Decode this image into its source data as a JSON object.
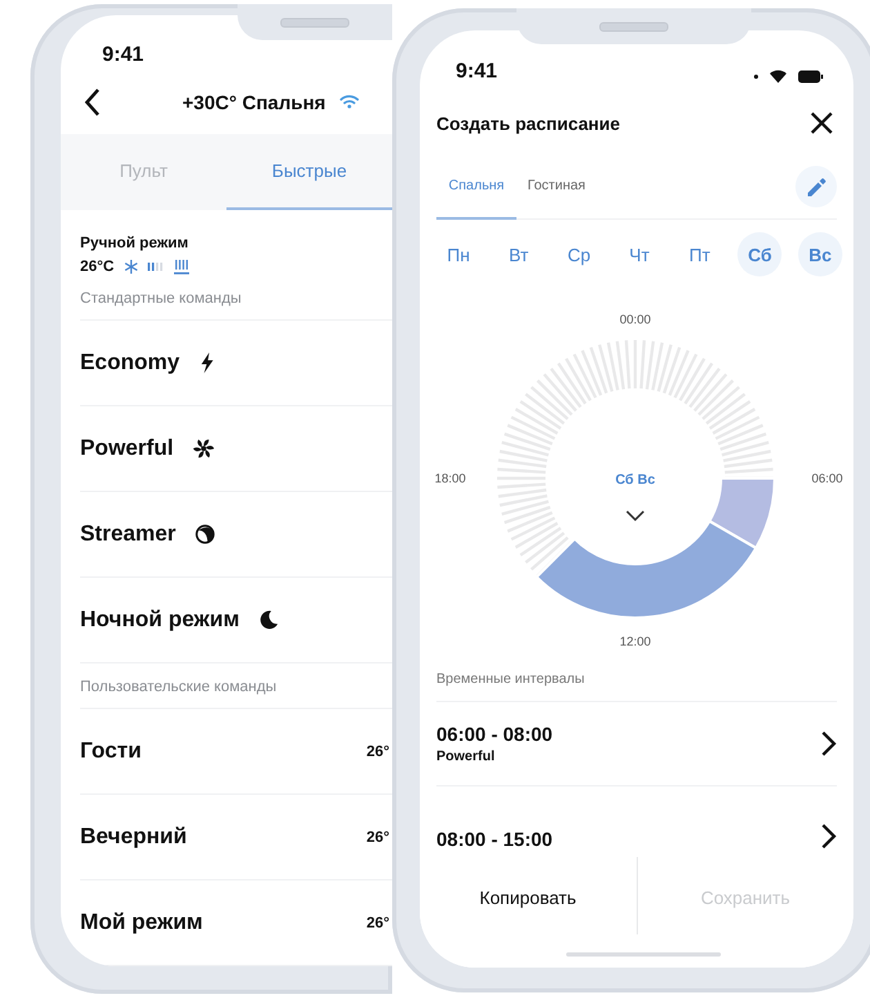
{
  "left_phone": {
    "status_time": "9:41",
    "header": {
      "title": "+30C° Спальня"
    },
    "tabs": [
      {
        "label": "Пульт",
        "selected": false
      },
      {
        "label": "Быстрые",
        "selected": true
      }
    ],
    "manual_mode": {
      "title": "Ручной режим",
      "temperature": "26°C"
    },
    "standard_section": "Стандартные команды",
    "standard_commands": [
      {
        "label": "Economy"
      },
      {
        "label": "Powerful"
      },
      {
        "label": "Streamer"
      },
      {
        "label": "Ночной режим"
      }
    ],
    "custom_section": "Пользовательские команды",
    "custom_commands": [
      {
        "label": "Гости",
        "temperature": "26°"
      },
      {
        "label": "Вечерний",
        "temperature": "26°"
      },
      {
        "label": "Мой режим",
        "temperature": "26°"
      }
    ]
  },
  "right_phone": {
    "status_time": "9:41",
    "title": "Создать расписание",
    "rooms": [
      {
        "label": "Спальня",
        "selected": true
      },
      {
        "label": "Гостиная",
        "selected": false
      }
    ],
    "days": [
      {
        "label": "Пн",
        "selected": false
      },
      {
        "label": "Вт",
        "selected": false
      },
      {
        "label": "Ср",
        "selected": false
      },
      {
        "label": "Чт",
        "selected": false
      },
      {
        "label": "Пт",
        "selected": false
      },
      {
        "label": "Сб",
        "selected": true
      },
      {
        "label": "Вс",
        "selected": true
      }
    ],
    "dial": {
      "top_label": "00:00",
      "right_label": "06:00",
      "bottom_label": "12:00",
      "left_label": "18:00",
      "center": "Сб Вс"
    },
    "intervals_section": "Временные интервалы",
    "intervals": [
      {
        "time": "06:00 - 08:00",
        "mode": "Powerful",
        "color": "#b4bce2"
      },
      {
        "time": "08:00 - 15:00",
        "color": "#90abdc"
      }
    ],
    "actions": [
      {
        "label": "Копировать",
        "disabled": false
      },
      {
        "label": "Сохранить",
        "disabled": true
      }
    ]
  }
}
